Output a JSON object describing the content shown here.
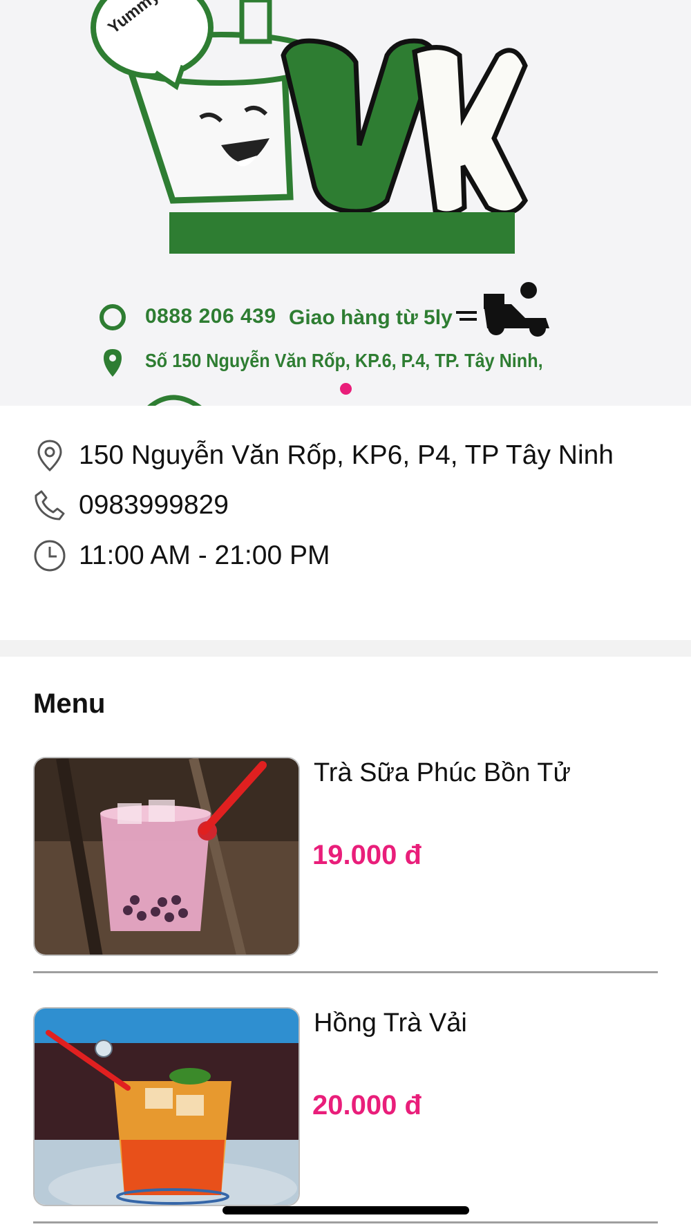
{
  "banner": {
    "logo_text": "VK",
    "tagline": "Yummy",
    "phone": "0888 206 439",
    "delivery": "Giao hàng từ 5ly",
    "address": "Số 150 Nguyễn Văn Rốp, KP.6, P.4, TP. Tây Ninh,",
    "slide_indicator_color": "#e91e7a"
  },
  "info": {
    "address": "150 Nguyễn Văn Rốp, KP6, P4, TP Tây Ninh",
    "phone": "0983999829",
    "hours": "11:00 AM - 21:00 PM",
    "icons": [
      "location-pin-icon",
      "phone-icon",
      "clock-icon"
    ]
  },
  "menu": {
    "title": "Menu",
    "items": [
      {
        "name": "Trà Sữa Phúc Bồn Tử",
        "price": "19.000 đ"
      },
      {
        "name": "Hồng Trà Vải",
        "price": "20.000 đ"
      }
    ]
  },
  "colors": {
    "accent": "#e91e7a",
    "brand_green": "#2e7d32"
  }
}
